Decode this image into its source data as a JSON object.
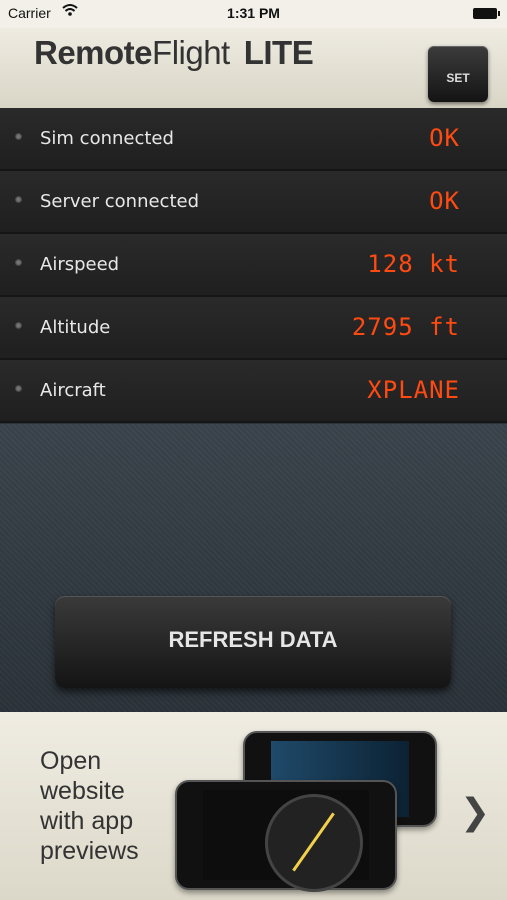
{
  "status_bar": {
    "carrier": "Carrier",
    "time": "1:31 PM"
  },
  "header": {
    "title_part1": "Remote",
    "title_part2": "Flight",
    "title_part3": "LITE",
    "set_button": "SET"
  },
  "rows": [
    {
      "label": "Sim connected",
      "value": "OK"
    },
    {
      "label": "Server connected",
      "value": "OK"
    },
    {
      "label": "Airspeed",
      "value": "128 kt"
    },
    {
      "label": "Altitude",
      "value": "2795 ft"
    },
    {
      "label": "Aircraft",
      "value": "XPLANE"
    }
  ],
  "refresh_button": "REFRESH DATA",
  "banner": {
    "text": "Open website with app previews"
  },
  "colors": {
    "value_accent": "#ff4a12"
  }
}
